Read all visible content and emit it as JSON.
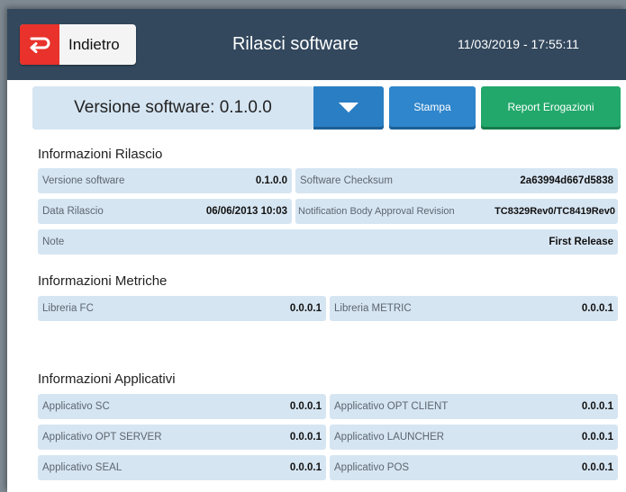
{
  "header": {
    "back_label": "Indietro",
    "title": "Rilasci software",
    "datetime": "11/03/2019 - 17:55:11"
  },
  "toolbar": {
    "version_select": "Versione software: 0.1.0.0",
    "print_label": "Stampa",
    "report_label": "Report Erogazioni"
  },
  "colors": {
    "header_bg": "#33485d",
    "back_accent": "#e8322b",
    "primary_blue": "#2f86cc",
    "report_green": "#22a86b",
    "field_bg": "#d6e5f2"
  },
  "release_info": {
    "title": "Informazioni Rilascio",
    "fields": [
      {
        "label": "Versione software",
        "value": "0.1.0.0"
      },
      {
        "label": "Software Checksum",
        "value": "2a63994d667d5838"
      },
      {
        "label": "Data Rilascio",
        "value": "06/06/2013 10:03"
      },
      {
        "label": "Notification Body Approval Revision",
        "value": "TC8329Rev0/TC8419Rev0"
      },
      {
        "label": "Note",
        "value": "First Release"
      }
    ]
  },
  "metrics_info": {
    "title": "Informazioni Metriche",
    "fields": [
      {
        "label": "Libreria FC",
        "value": "0.0.0.1"
      },
      {
        "label": "Libreria METRIC",
        "value": "0.0.0.1"
      }
    ]
  },
  "apps_info": {
    "title": "Informazioni Applicativi",
    "fields": [
      {
        "label": "Applicativo SC",
        "value": "0.0.0.1"
      },
      {
        "label": "Applicativo OPT CLIENT",
        "value": "0.0.0.1"
      },
      {
        "label": "Applicativo OPT SERVER",
        "value": "0.0.0.1"
      },
      {
        "label": "Applicativo LAUNCHER",
        "value": "0.0.0.1"
      },
      {
        "label": "Applicativo SEAL",
        "value": "0.0.0.1"
      },
      {
        "label": "Applicativo POS",
        "value": "0.0.0.1"
      }
    ]
  }
}
